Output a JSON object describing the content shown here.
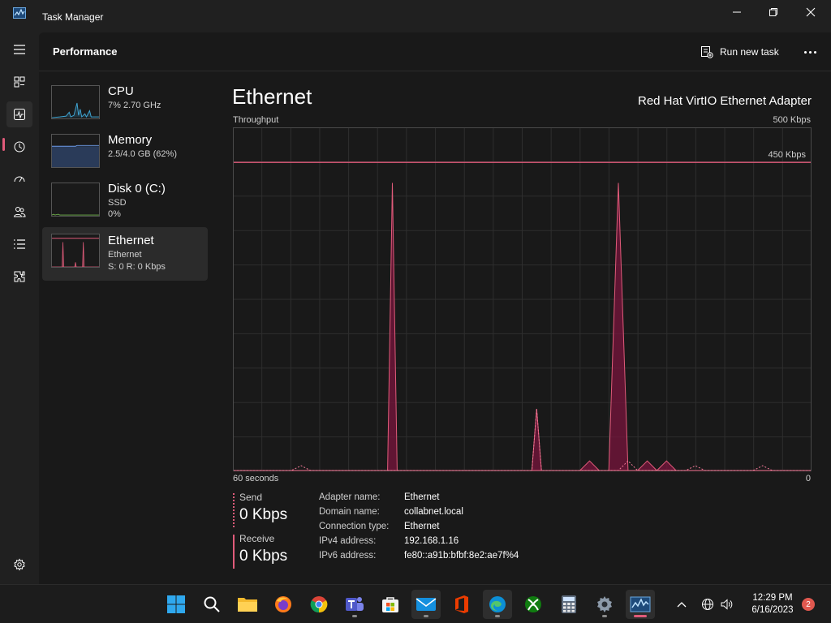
{
  "window": {
    "title": "Task Manager"
  },
  "header": {
    "title": "Performance",
    "run_task_label": "Run new task"
  },
  "resources": [
    {
      "name": "CPU",
      "line1": "7% 2.70 GHz",
      "line2": "",
      "color": "#3fa7d6"
    },
    {
      "name": "Memory",
      "line1": "2.5/4.0 GB (62%)",
      "line2": "",
      "color": "#4b7bd1"
    },
    {
      "name": "Disk 0 (C:)",
      "line1": "SSD",
      "line2": "0%",
      "color": "#6fb04a"
    },
    {
      "name": "Ethernet",
      "line1": "Ethernet",
      "line2": "S: 0 R: 0 Kbps",
      "color": "#e05b7a"
    }
  ],
  "detail": {
    "title": "Ethernet",
    "adapter": "Red Hat VirtIO Ethernet Adapter",
    "throughput_label": "Throughput",
    "max_label": "500 Kbps",
    "ref_label": "450 Kbps",
    "time_label": "60 seconds",
    "zero_label": "0"
  },
  "stats": {
    "send_label": "Send",
    "send_value": "0 Kbps",
    "receive_label": "Receive",
    "receive_value": "0 Kbps"
  },
  "properties": [
    {
      "key": "Adapter name:",
      "value": "Ethernet"
    },
    {
      "key": "Domain name:",
      "value": "collabnet.local"
    },
    {
      "key": "Connection type:",
      "value": "Ethernet"
    },
    {
      "key": "IPv4 address:",
      "value": "192.168.1.16"
    },
    {
      "key": "IPv6 address:",
      "value": "fe80::a91b:bfbf:8e2:ae7f%4"
    }
  ],
  "taskbar": {
    "time": "12:29 PM",
    "date": "6/16/2023",
    "notifications": "2",
    "apps": [
      "start-icon",
      "search-icon",
      "file-explorer-icon",
      "firefox-icon",
      "chrome-icon",
      "teams-icon",
      "store-icon",
      "mail-icon",
      "office-icon",
      "edge-icon",
      "xbox-icon",
      "calculator-icon",
      "settings-icon",
      "task-manager-icon"
    ]
  },
  "colors": {
    "accent": "#e05b7a",
    "receive": "#e05b7a",
    "send": "#e05b7a"
  },
  "chart_data": {
    "type": "area",
    "ylim": [
      0,
      500
    ],
    "x_range_seconds": 60,
    "reference_line": 450,
    "receive": [
      0,
      0,
      0,
      0,
      0,
      0,
      0,
      0,
      0,
      0,
      0,
      0,
      0,
      0,
      0,
      0,
      0,
      0,
      0,
      0,
      0,
      0,
      0,
      0,
      0,
      0,
      0,
      0,
      0,
      0,
      0,
      0,
      0,
      0,
      0,
      0,
      0,
      0,
      0,
      0,
      0,
      0,
      0,
      0,
      0,
      0,
      0,
      0,
      0,
      0,
      0,
      0,
      0,
      0,
      0,
      0,
      0,
      0,
      0,
      0,
      0
    ],
    "series": [
      {
        "name": "Receive",
        "x": [
          0,
          15,
          16,
          16.5,
          17,
          18,
          19,
          20,
          30,
          31,
          31.5,
          32,
          33,
          36,
          37,
          38,
          39,
          40,
          41,
          42,
          43,
          44,
          45,
          46,
          47,
          48,
          49,
          60
        ],
        "y": [
          0,
          0,
          0,
          420,
          0,
          0,
          0,
          0,
          0,
          0,
          90,
          0,
          0,
          0,
          14,
          0,
          0,
          420,
          0,
          0,
          14,
          0,
          14,
          0,
          0,
          0,
          0,
          0
        ]
      },
      {
        "name": "Send",
        "x": [
          0,
          6,
          7,
          8,
          17,
          18,
          31,
          31.5,
          32,
          40,
          41,
          42,
          47,
          48,
          49,
          52,
          53,
          54,
          55,
          56,
          57,
          60
        ],
        "y": [
          0,
          0,
          7,
          0,
          0,
          0,
          0,
          90,
          0,
          0,
          14,
          0,
          0,
          7,
          0,
          0,
          0,
          0,
          7,
          0,
          0,
          0
        ]
      }
    ]
  }
}
